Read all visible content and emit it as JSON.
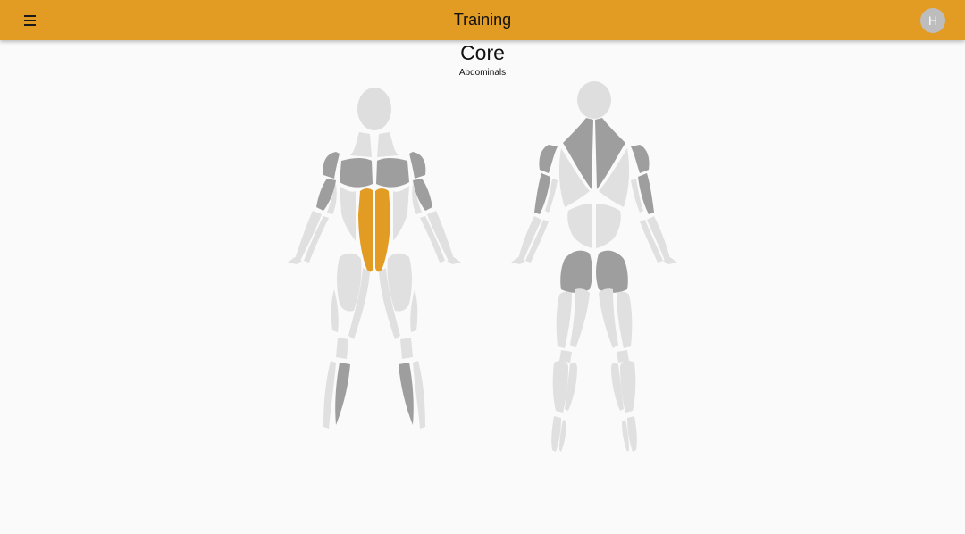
{
  "app_bar": {
    "title": "Training",
    "menu_icon": "hamburger-menu-icon",
    "avatar_letter": "H"
  },
  "muscle_group": {
    "title": "Core",
    "subtitle": "Abdominals"
  },
  "colors": {
    "accent": "#e39c23",
    "muscle_inactive": "#e0e0e0",
    "muscle_secondary": "#9e9e9e",
    "muscle_selected": "#e39c23",
    "background": "#fafafa"
  },
  "body_views": {
    "front": {
      "highlighted": [
        "abdominals"
      ],
      "secondary": [
        "chest",
        "shoulders",
        "biceps",
        "calves"
      ]
    },
    "back": {
      "highlighted": [],
      "secondary": [
        "trapezius",
        "shoulders",
        "triceps",
        "glutes"
      ]
    }
  }
}
